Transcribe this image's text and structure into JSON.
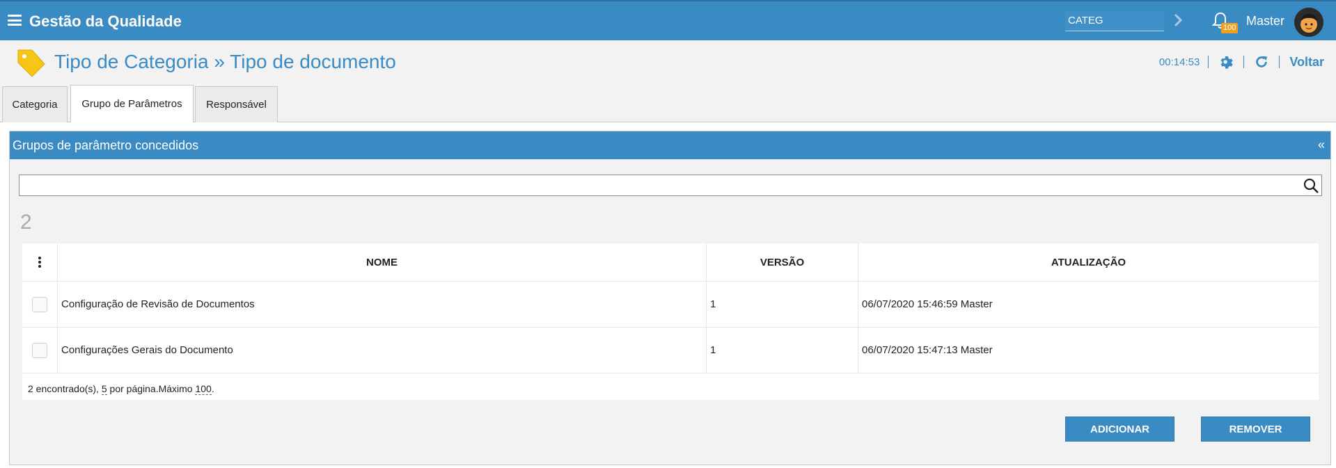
{
  "topbar": {
    "app_title": "Gestão da Qualidade",
    "search_value": "CATEG",
    "notification_count": "100",
    "user_name": "Master"
  },
  "header": {
    "title": "Tipo de Categoria » Tipo de documento",
    "timer": "00:14:53",
    "back_label": "Voltar"
  },
  "tabs": [
    {
      "label": "Categoria",
      "active": false
    },
    {
      "label": "Grupo de Parâmetros",
      "active": true
    },
    {
      "label": "Responsável",
      "active": false
    }
  ],
  "panel": {
    "title": "Grupos de parâmetro concedidos",
    "collapse_label": "«",
    "search_value": "",
    "result_count": "2"
  },
  "table": {
    "columns": [
      "NOME",
      "VERSÃO",
      "ATUALIZAÇÃO"
    ],
    "rows": [
      {
        "nome": "Configuração de Revisão de Documentos",
        "versao": "1",
        "atualizacao": "06/07/2020 15:46:59 Master"
      },
      {
        "nome": "Configurações Gerais do Documento",
        "versao": "1",
        "atualizacao": "06/07/2020 15:47:13 Master"
      }
    ],
    "footer": {
      "found": "2 encontrado(s), ",
      "per_page": "5",
      "per_page_suffix": " por página.Máximo ",
      "max": "100",
      "end": "."
    }
  },
  "buttons": {
    "add": "ADICIONAR",
    "remove": "REMOVER"
  },
  "colors": {
    "primary": "#3a8ac4",
    "badge": "#f0a020",
    "tag_icon": "#f5c518"
  }
}
